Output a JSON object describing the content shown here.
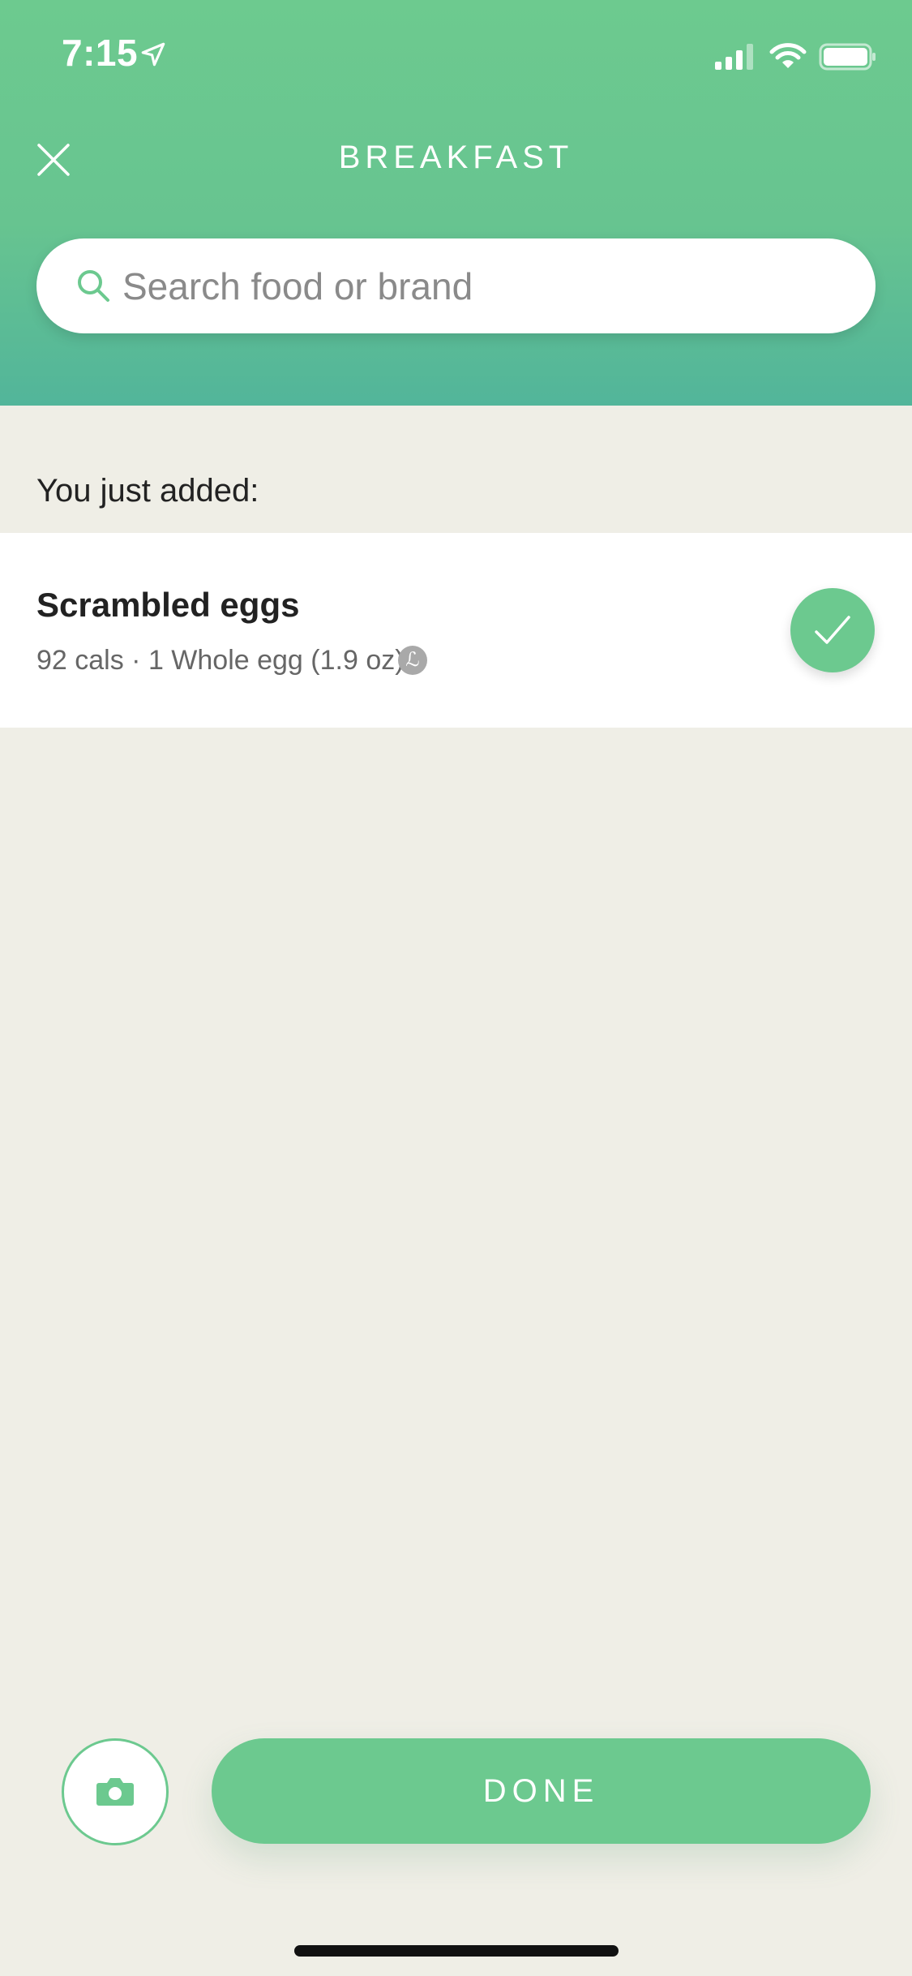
{
  "status_bar": {
    "time": "7:15"
  },
  "header": {
    "title": "BREAKFAST"
  },
  "search": {
    "placeholder": "Search food or brand",
    "value": ""
  },
  "recent": {
    "label": "You just added:",
    "item": {
      "name": "Scrambled eggs",
      "details": "92 cals · 1 Whole egg (1.9 oz)",
      "badge": "ℒ"
    }
  },
  "footer": {
    "done_label": "DONE"
  },
  "colors": {
    "accent": "#6cc98f",
    "header_top": "#6dca8f",
    "header_bottom": "#52b59a",
    "background": "#efeee6"
  },
  "icons": {
    "close": "close-icon",
    "search": "search-icon",
    "check": "check-icon",
    "camera": "camera-icon",
    "location": "location-arrow-icon",
    "signal": "cellular-signal-icon",
    "wifi": "wifi-icon",
    "battery": "battery-icon"
  }
}
